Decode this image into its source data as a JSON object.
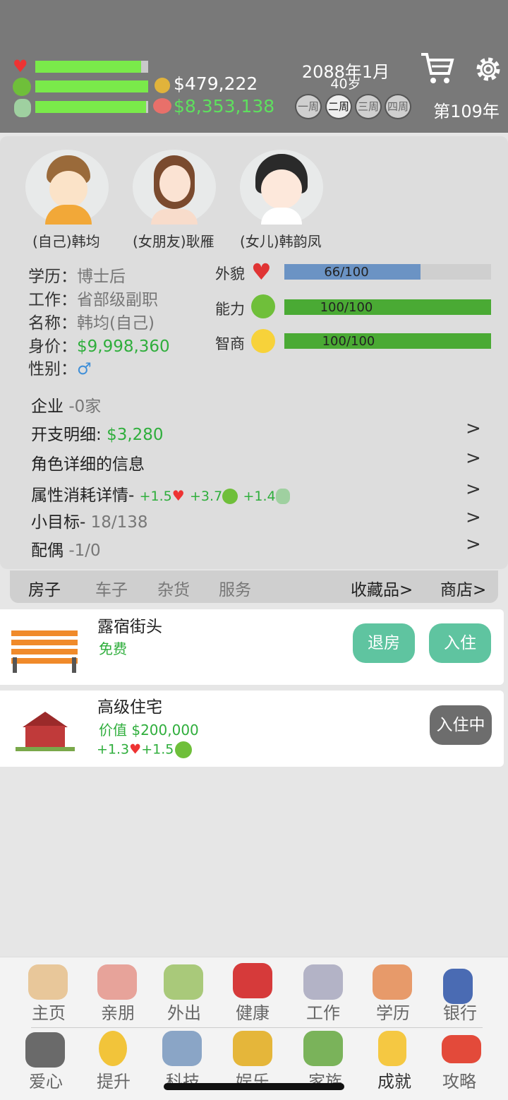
{
  "header": {
    "money": "$479,222",
    "assets": "$8,353,138",
    "date": "2088年1月",
    "age": "40岁",
    "weeks": [
      "一周",
      "二周",
      "三周",
      "四周"
    ],
    "selected_week": "二周",
    "year": "第109年",
    "health_pct": 94,
    "mood_pct": 100,
    "intel_pct": 98
  },
  "family": [
    {
      "name": "(自己)韩均"
    },
    {
      "name": "(女朋友)耿雁"
    },
    {
      "name": "(女儿)韩韵凤"
    }
  ],
  "profile": {
    "education_label": "学历：",
    "education": "博士后",
    "job_label": "工作：",
    "job": "省部级副职",
    "name_label": "名称：",
    "name": "韩均(自己)",
    "worth_label": "身价：",
    "worth": "$9,998,360",
    "gender_label": "性别：",
    "gender": "♂"
  },
  "attributes": [
    {
      "label": "外貌",
      "value": "66/100",
      "pct": 66,
      "color": "#6b93c4"
    },
    {
      "label": "能力",
      "value": "100/100",
      "pct": 100,
      "color": "#4aaa34"
    },
    {
      "label": "智商",
      "value": "100/100",
      "pct": 100,
      "color": "#4aaa34"
    }
  ],
  "details": {
    "company_label": "企业",
    "company_value": "-0家",
    "expense_label": "开支明细:",
    "expense_value": "$3,280",
    "role_info": "角色详细的信息",
    "consume_label": "属性消耗详情-",
    "consume_1": "+1.5",
    "consume_2": "+3.7",
    "consume_3": "+1.4",
    "goal_label": "小目标-",
    "goal_value": "18/138",
    "spouse_label": "配偶",
    "spouse_value": "-1/0"
  },
  "tabs": {
    "house": "房子",
    "car": "车子",
    "goods": "杂货",
    "service": "服务",
    "collection": "收藏品",
    "shop": "商店"
  },
  "houses": [
    {
      "name": "露宿街头",
      "price": "免费",
      "btn1": "退房",
      "btn2": "入住"
    },
    {
      "name": "高级住宅",
      "price": "价值 $200,000",
      "bonus1": "+1.3",
      "bonus2": "+1.5",
      "btn": "入住中"
    }
  ],
  "nav": {
    "row1": [
      "主页",
      "亲朋",
      "外出",
      "健康",
      "工作",
      "学历",
      "银行"
    ],
    "row2": [
      "爱心",
      "提升",
      "科技",
      "娱乐",
      "家族",
      "成就",
      "攻略"
    ]
  }
}
